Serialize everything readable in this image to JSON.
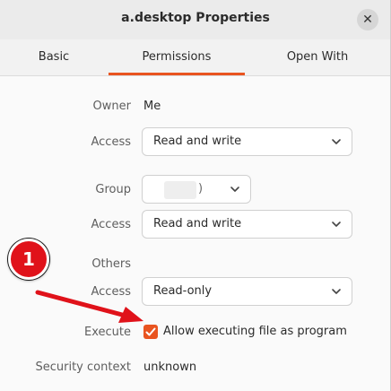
{
  "window": {
    "title": "a.desktop Properties",
    "close_glyph": "✕"
  },
  "tabs": [
    {
      "label": "Basic"
    },
    {
      "label": "Permissions",
      "active": true
    },
    {
      "label": "Open With"
    }
  ],
  "owner": {
    "label": "Owner",
    "value": "Me"
  },
  "owner_access": {
    "label": "Access",
    "value": "Read and write"
  },
  "group": {
    "label": "Group",
    "value": ")"
  },
  "group_access": {
    "label": "Access",
    "value": "Read and write"
  },
  "others": {
    "label": "Others"
  },
  "others_access": {
    "label": "Access",
    "value": "Read-only"
  },
  "execute": {
    "label": "Execute",
    "checkbox_label": "Allow executing file as program",
    "checked": true
  },
  "security": {
    "label": "Security context",
    "value": "unknown"
  },
  "annotation": {
    "badge_number": "1"
  },
  "colors": {
    "accent": "#e95420",
    "annotation_red": "#e0121a"
  }
}
